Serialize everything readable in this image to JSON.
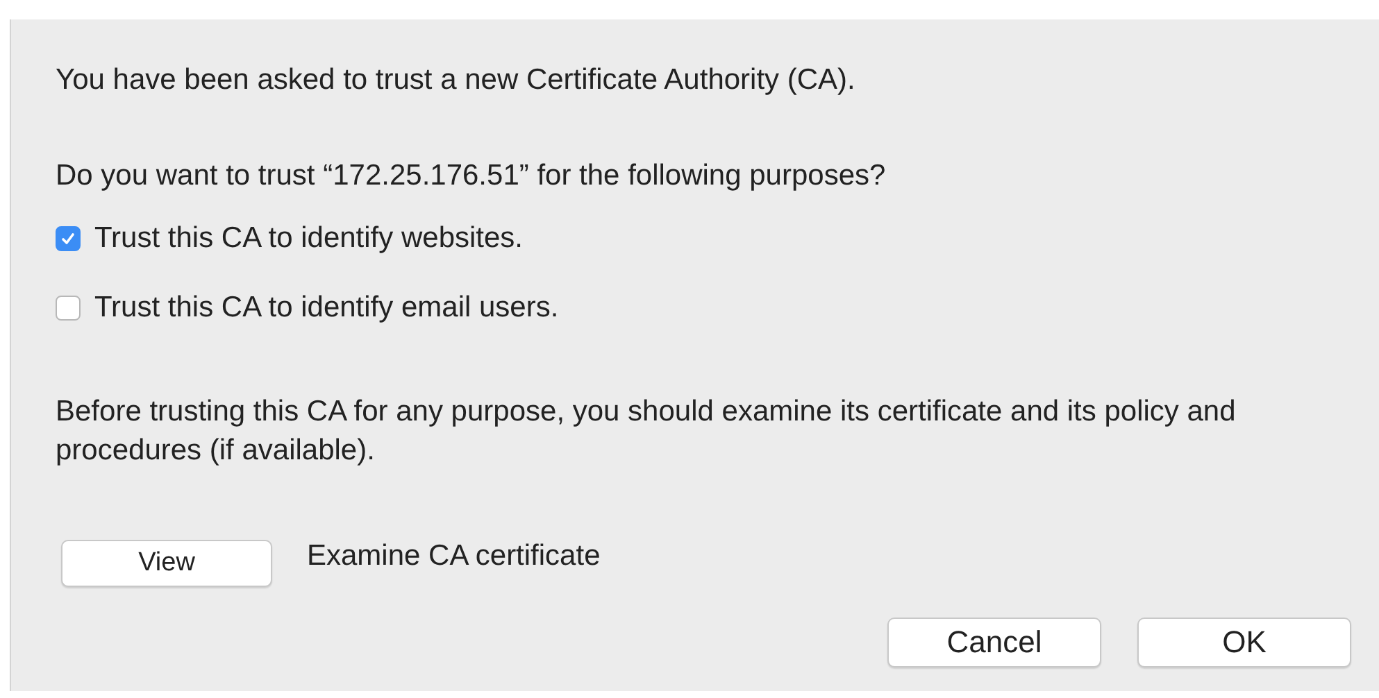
{
  "intro": "You have been asked to trust a new Certificate Authority (CA).",
  "question": "Do you want to trust “172.25.176.51” for the following purposes?",
  "options": [
    {
      "label": "Trust this CA to identify websites.",
      "checked": true
    },
    {
      "label": "Trust this CA to identify email users.",
      "checked": false
    }
  ],
  "advice": "Before trusting this CA for any purpose, you should examine its certificate and its policy and procedures (if available).",
  "view": {
    "button": "View",
    "description": "Examine CA certificate"
  },
  "buttons": [
    "Cancel",
    "OK"
  ]
}
